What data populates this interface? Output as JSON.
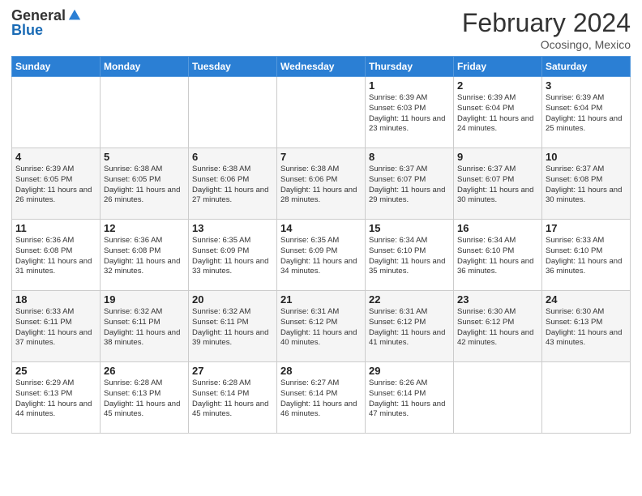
{
  "header": {
    "logo_general": "General",
    "logo_blue": "Blue",
    "month_year": "February 2024",
    "location": "Ocosingo, Mexico"
  },
  "days_of_week": [
    "Sunday",
    "Monday",
    "Tuesday",
    "Wednesday",
    "Thursday",
    "Friday",
    "Saturday"
  ],
  "weeks": [
    [
      {
        "day": "",
        "info": ""
      },
      {
        "day": "",
        "info": ""
      },
      {
        "day": "",
        "info": ""
      },
      {
        "day": "",
        "info": ""
      },
      {
        "day": "1",
        "info": "Sunrise: 6:39 AM\nSunset: 6:03 PM\nDaylight: 11 hours and 23 minutes."
      },
      {
        "day": "2",
        "info": "Sunrise: 6:39 AM\nSunset: 6:04 PM\nDaylight: 11 hours and 24 minutes."
      },
      {
        "day": "3",
        "info": "Sunrise: 6:39 AM\nSunset: 6:04 PM\nDaylight: 11 hours and 25 minutes."
      }
    ],
    [
      {
        "day": "4",
        "info": "Sunrise: 6:39 AM\nSunset: 6:05 PM\nDaylight: 11 hours and 26 minutes."
      },
      {
        "day": "5",
        "info": "Sunrise: 6:38 AM\nSunset: 6:05 PM\nDaylight: 11 hours and 26 minutes."
      },
      {
        "day": "6",
        "info": "Sunrise: 6:38 AM\nSunset: 6:06 PM\nDaylight: 11 hours and 27 minutes."
      },
      {
        "day": "7",
        "info": "Sunrise: 6:38 AM\nSunset: 6:06 PM\nDaylight: 11 hours and 28 minutes."
      },
      {
        "day": "8",
        "info": "Sunrise: 6:37 AM\nSunset: 6:07 PM\nDaylight: 11 hours and 29 minutes."
      },
      {
        "day": "9",
        "info": "Sunrise: 6:37 AM\nSunset: 6:07 PM\nDaylight: 11 hours and 30 minutes."
      },
      {
        "day": "10",
        "info": "Sunrise: 6:37 AM\nSunset: 6:08 PM\nDaylight: 11 hours and 30 minutes."
      }
    ],
    [
      {
        "day": "11",
        "info": "Sunrise: 6:36 AM\nSunset: 6:08 PM\nDaylight: 11 hours and 31 minutes."
      },
      {
        "day": "12",
        "info": "Sunrise: 6:36 AM\nSunset: 6:08 PM\nDaylight: 11 hours and 32 minutes."
      },
      {
        "day": "13",
        "info": "Sunrise: 6:35 AM\nSunset: 6:09 PM\nDaylight: 11 hours and 33 minutes."
      },
      {
        "day": "14",
        "info": "Sunrise: 6:35 AM\nSunset: 6:09 PM\nDaylight: 11 hours and 34 minutes."
      },
      {
        "day": "15",
        "info": "Sunrise: 6:34 AM\nSunset: 6:10 PM\nDaylight: 11 hours and 35 minutes."
      },
      {
        "day": "16",
        "info": "Sunrise: 6:34 AM\nSunset: 6:10 PM\nDaylight: 11 hours and 36 minutes."
      },
      {
        "day": "17",
        "info": "Sunrise: 6:33 AM\nSunset: 6:10 PM\nDaylight: 11 hours and 36 minutes."
      }
    ],
    [
      {
        "day": "18",
        "info": "Sunrise: 6:33 AM\nSunset: 6:11 PM\nDaylight: 11 hours and 37 minutes."
      },
      {
        "day": "19",
        "info": "Sunrise: 6:32 AM\nSunset: 6:11 PM\nDaylight: 11 hours and 38 minutes."
      },
      {
        "day": "20",
        "info": "Sunrise: 6:32 AM\nSunset: 6:11 PM\nDaylight: 11 hours and 39 minutes."
      },
      {
        "day": "21",
        "info": "Sunrise: 6:31 AM\nSunset: 6:12 PM\nDaylight: 11 hours and 40 minutes."
      },
      {
        "day": "22",
        "info": "Sunrise: 6:31 AM\nSunset: 6:12 PM\nDaylight: 11 hours and 41 minutes."
      },
      {
        "day": "23",
        "info": "Sunrise: 6:30 AM\nSunset: 6:12 PM\nDaylight: 11 hours and 42 minutes."
      },
      {
        "day": "24",
        "info": "Sunrise: 6:30 AM\nSunset: 6:13 PM\nDaylight: 11 hours and 43 minutes."
      }
    ],
    [
      {
        "day": "25",
        "info": "Sunrise: 6:29 AM\nSunset: 6:13 PM\nDaylight: 11 hours and 44 minutes."
      },
      {
        "day": "26",
        "info": "Sunrise: 6:28 AM\nSunset: 6:13 PM\nDaylight: 11 hours and 45 minutes."
      },
      {
        "day": "27",
        "info": "Sunrise: 6:28 AM\nSunset: 6:14 PM\nDaylight: 11 hours and 45 minutes."
      },
      {
        "day": "28",
        "info": "Sunrise: 6:27 AM\nSunset: 6:14 PM\nDaylight: 11 hours and 46 minutes."
      },
      {
        "day": "29",
        "info": "Sunrise: 6:26 AM\nSunset: 6:14 PM\nDaylight: 11 hours and 47 minutes."
      },
      {
        "day": "",
        "info": ""
      },
      {
        "day": "",
        "info": ""
      }
    ]
  ]
}
